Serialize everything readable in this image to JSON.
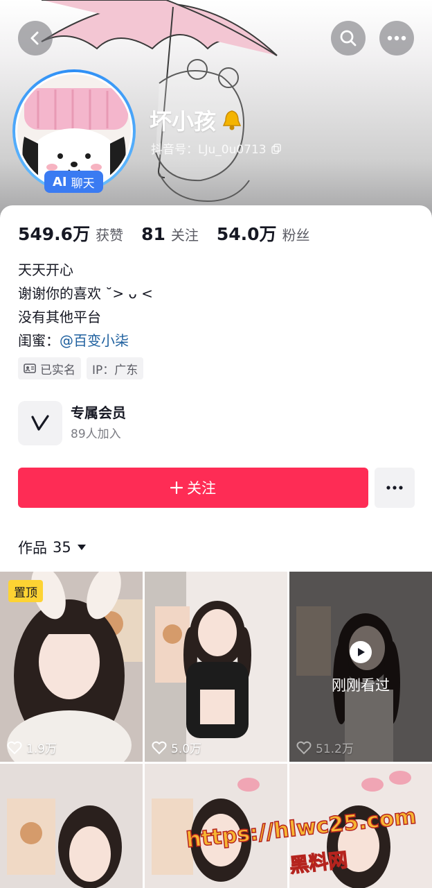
{
  "profile": {
    "nickname": "坏小孩",
    "douyin_id": "抖音号：LJu_0u0713",
    "ai_badge_prefix": "AI",
    "ai_badge_label": "聊天"
  },
  "stats": [
    {
      "value": "549.6万",
      "label": "获赞"
    },
    {
      "value": "81",
      "label": "关注"
    },
    {
      "value": "54.0万",
      "label": "粉丝"
    }
  ],
  "bio": {
    "line1": "天天开心",
    "line2": "谢谢你的喜欢 ˘> ᴗ <",
    "line3": "没有其他平台",
    "line4_prefix": "闺蜜：",
    "line4_mention": "@百变小柒"
  },
  "tags": {
    "verified": "已实名",
    "ip": "IP：广东"
  },
  "vip": {
    "title": "专属会员",
    "subtitle": "89人加入"
  },
  "actions": {
    "follow_label": "关注"
  },
  "works": {
    "tab_label": "作品",
    "count": "35"
  },
  "videos": [
    {
      "likes": "1.9万",
      "pinned": "置顶"
    },
    {
      "likes": "5.0万"
    },
    {
      "likes": "51.2万",
      "recent": "刚刚看过"
    },
    {},
    {},
    {}
  ],
  "watermark": {
    "url": "https://hlwc25.com",
    "name": "黑料网"
  },
  "colors": {
    "follow": "#fe2c55",
    "mention": "#1d5f9e",
    "pinned_badge": "#fdd333",
    "ai_badge": "#3a7bf2"
  }
}
